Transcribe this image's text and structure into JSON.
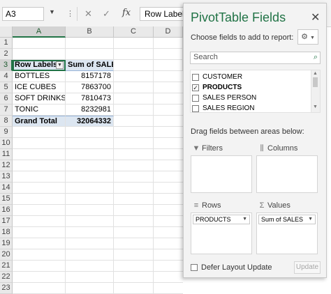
{
  "namebox": {
    "value": "A3"
  },
  "formula_bar": {
    "value": "Row Labels"
  },
  "spreadsheet": {
    "columns": [
      "A",
      "B",
      "C",
      "D"
    ],
    "rows": [
      "1",
      "2",
      "3",
      "4",
      "5",
      "6",
      "7",
      "8",
      "9",
      "10",
      "11",
      "12",
      "13",
      "14",
      "15",
      "16",
      "17",
      "18",
      "19",
      "20",
      "21",
      "22",
      "23"
    ],
    "header_row": {
      "row_labels": "Row Labels",
      "sum_of_sales": "Sum of SALES"
    },
    "data_rows": [
      {
        "label": "BOTTLES",
        "value": "8157178"
      },
      {
        "label": "ICE CUBES",
        "value": "7863700"
      },
      {
        "label": "SOFT DRINKS",
        "value": "7810473"
      },
      {
        "label": "TONIC",
        "value": "8232981"
      }
    ],
    "total_row": {
      "label": "Grand Total",
      "value": "32064332"
    }
  },
  "pivot_pane": {
    "title": "PivotTable Fields",
    "choose_label": "Choose fields to add to report:",
    "search_placeholder": "Search",
    "fields": [
      {
        "name": "CUSTOMER",
        "checked": false
      },
      {
        "name": "PRODUCTS",
        "checked": true
      },
      {
        "name": "SALES PERSON",
        "checked": false
      },
      {
        "name": "SALES REGION",
        "checked": false
      }
    ],
    "drag_label": "Drag fields between areas below:",
    "areas": {
      "filters": "Filters",
      "columns": "Columns",
      "rows": "Rows",
      "values": "Values"
    },
    "rows_item": "PRODUCTS",
    "values_item": "Sum of SALES",
    "defer_label": "Defer Layout Update",
    "update_label": "Update"
  },
  "icons": {
    "close": "close-icon",
    "gear": "gear-icon",
    "search": "search-icon",
    "filter": "filter-icon",
    "columns": "columns-icon",
    "rows": "rows-icon",
    "sigma": "sigma-icon"
  },
  "colors": {
    "accent": "#217346",
    "pivot_header_bg": "#dce6f1"
  }
}
